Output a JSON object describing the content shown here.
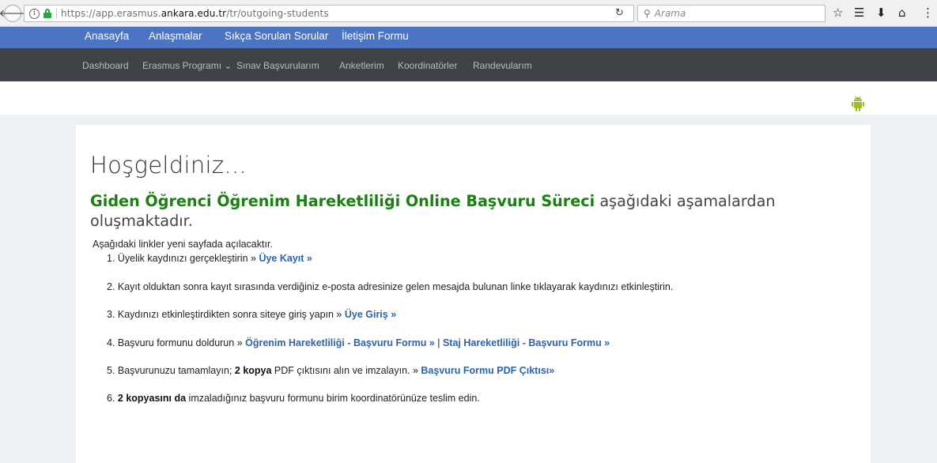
{
  "browser": {
    "url_prefix": "https://app.erasmus.",
    "url_domain": "ankara.edu.tr",
    "url_path": "/tr/outgoing-students",
    "search_placeholder": "Arama"
  },
  "topnav": {
    "items": [
      "Anasayfa",
      "Anlaşmalar",
      "Sıkça Sorulan Sorular",
      "İletişim Formu"
    ]
  },
  "subnav": {
    "items": [
      "Dashboard",
      "Erasmus Programı",
      "Sınav Başvurularım",
      "Anketlerim",
      "Koordinatörler",
      "Randevularım"
    ],
    "dropdown_marker": "⌄"
  },
  "main": {
    "welcome": "Hoşgeldiniz...",
    "headline_bold": "Giden Öğrenci Öğrenim Hareketliliği Online Başvuru Süreci",
    "headline_rest": " aşağıdaki aşamalardan oluşmaktadır.",
    "intro": "Aşağıdaki linkler yeni sayfada açılacaktır.",
    "steps": {
      "s1_text": "1. Üyelik kaydınızı gerçekleştirin » ",
      "s1_link": "Üye Kayıt »",
      "s2_text": "2. Kayıt olduktan sonra kayıt sırasında verdiğiniz e-posta adresinize gelen mesajda bulunan linke tıklayarak kaydınızı etkinleştirin.",
      "s3_text": "3. Kaydınızı etkinleştirdikten sonra siteye giriş yapın » ",
      "s3_link": "Üye Giriş »",
      "s4_text": "4. Başvuru formunu doldurun » ",
      "s4_link1": "Öğrenim Hareketliliği - Başvuru Formu »",
      "s4_sep": " | ",
      "s4_link2": "Staj Hareketliliği - Başvuru Formu »",
      "s5_text1": "5. Başvurunuzu tamamlayın; ",
      "s5_bold": "2 kopya",
      "s5_text2": " PDF çıktısını alın ve imzalayın. » ",
      "s5_link": "Başvuru Formu PDF Çıktısı»",
      "s6_text1": "6. ",
      "s6_bold": "2 kopyasını da",
      "s6_text2": " imzaladığınız başvuru formunu birim koordinatörünüze teslim edin."
    }
  },
  "colors": {
    "topnav_bg": "#4c74c3",
    "subnav_bg": "#3f4348",
    "headline_green": "#1b7f12",
    "link_blue": "#2b63b4",
    "android_green": "#97c024"
  }
}
